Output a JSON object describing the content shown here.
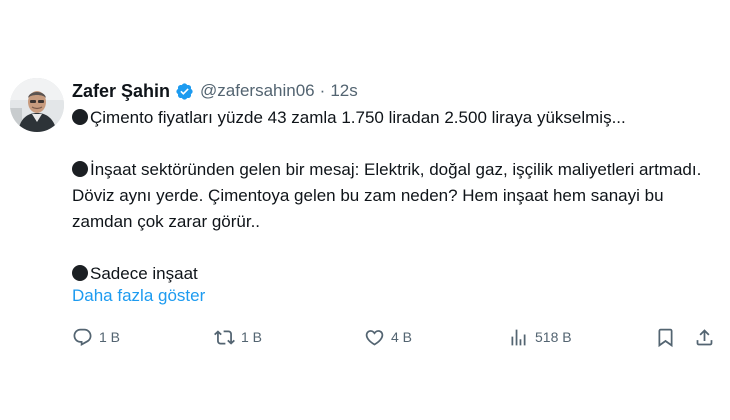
{
  "author": {
    "display_name": "Zafer Şahin",
    "handle": "@zafersahin06",
    "separator": "·",
    "time": "12s",
    "verified": true,
    "verified_color": "#1d9bf0"
  },
  "tweet": {
    "paragraphs": [
      "Çimento fiyatları yüzde 43 zamla 1.750 liradan 2.500 liraya yükselmiş...",
      "İnşaat sektöründen gelen bir mesaj: Elektrik, doğal gaz, işçilik maliyetleri artmadı. Döviz aynı yerde. Çimentoya gelen bu zam neden? Hem inşaat hem sanayi bu zamdan çok zarar görür..",
      "Sadece inşaat"
    ],
    "bullet_icon": "black-circle-icon",
    "show_more": "Daha fazla göster",
    "link_color": "#1d9bf0"
  },
  "actions": {
    "reply": {
      "icon": "reply-icon",
      "count": "1 B"
    },
    "retweet": {
      "icon": "retweet-icon",
      "count": "1 B"
    },
    "like": {
      "icon": "heart-icon",
      "count": "4 B"
    },
    "views": {
      "icon": "views-chart-icon",
      "count": "518 B"
    },
    "bookmark": {
      "icon": "bookmark-icon"
    },
    "share": {
      "icon": "share-icon"
    }
  }
}
